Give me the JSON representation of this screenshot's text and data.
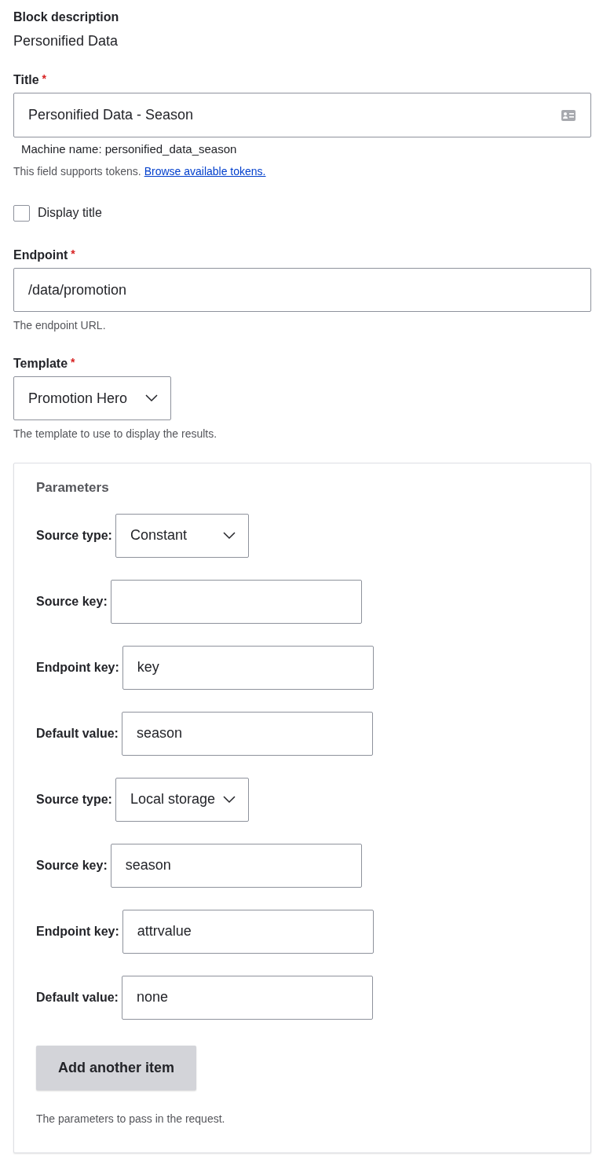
{
  "block_description": {
    "label": "Block description",
    "value": "Personified Data"
  },
  "title_field": {
    "label": "Title",
    "required_mark": "*",
    "value": "Personified Data - Season",
    "machine_name": "Machine name: personified_data_season",
    "help": "This field supports tokens.",
    "help_link": "Browse available tokens."
  },
  "display_title": {
    "label": "Display title",
    "checked": false
  },
  "endpoint": {
    "label": "Endpoint",
    "required_mark": "*",
    "value": "/data/promotion",
    "help": "The endpoint URL."
  },
  "template": {
    "label": "Template",
    "required_mark": "*",
    "value": "Promotion Hero",
    "help": "The template to use to display the results."
  },
  "parameters": {
    "title": "Parameters",
    "rows": [
      {
        "kind": "select",
        "label": "Source type:",
        "value": "Constant"
      },
      {
        "kind": "text",
        "label": "Source key:",
        "value": ""
      },
      {
        "kind": "text",
        "label": "Endpoint key:",
        "value": "key"
      },
      {
        "kind": "text",
        "label": "Default value:",
        "value": "season"
      },
      {
        "kind": "select",
        "label": "Source type:",
        "value": "Local storage"
      },
      {
        "kind": "text",
        "label": "Source key:",
        "value": "season"
      },
      {
        "kind": "text",
        "label": "Endpoint key:",
        "value": "attrvalue"
      },
      {
        "kind": "text",
        "label": "Default value:",
        "value": "none"
      }
    ],
    "button": "Add another item",
    "help": "The parameters to pass in the request."
  }
}
